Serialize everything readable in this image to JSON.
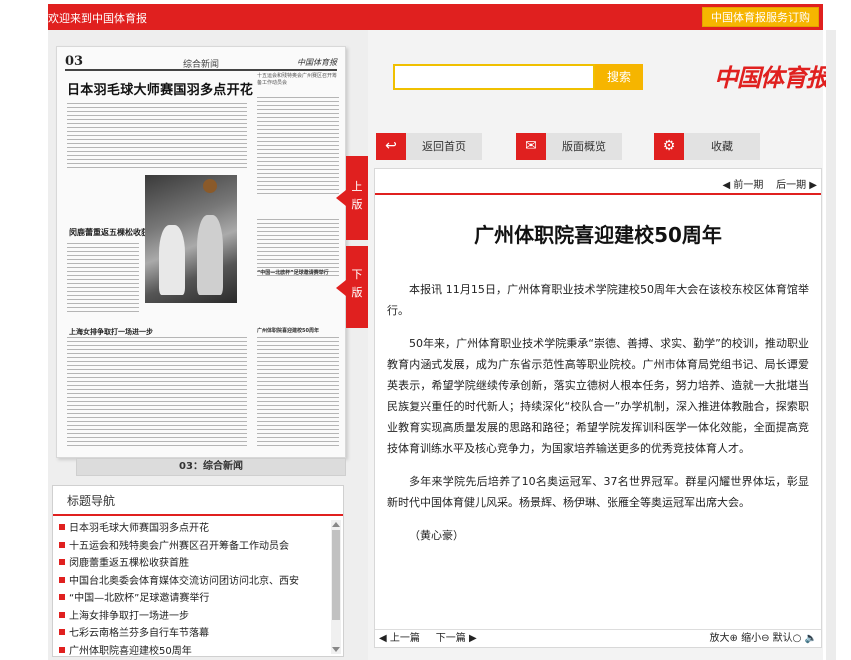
{
  "topbar": {
    "welcome": "欢迎来到中国体育报",
    "subscribe": "中国体育报服务订购"
  },
  "paper": {
    "page_num": "03",
    "section": "综合新闻",
    "masthead_small": "中国体育报",
    "headline": "日本羽毛球大师赛国羽多点开花",
    "side_titles": [
      "十五运会和残特奥会广州赛区召开筹备工作动员会",
      "闵鹿蕾重返五棵松收获首胜",
      "中国台北奥委会体育媒体交流访问团访问北京、西安",
      "“中国—北欧杯”足球邀请赛举行",
      "上海女排争取打一场进一步",
      "七彩云南格兰芬多自行车节落幕",
      "广州体职院喜迎建校50周年"
    ],
    "caption": "03：综合新闻"
  },
  "tabs": {
    "up": "上版",
    "down": "下版"
  },
  "nav": {
    "title": "标题导航",
    "items": [
      "日本羽毛球大师赛国羽多点开花",
      "十五运会和残特奥会广州赛区召开筹备工作动员会",
      "闵鹿蕾重返五棵松收获首胜",
      "中国台北奥委会体育媒体交流访问团访问北京、西安",
      "“中国—北欧杯”足球邀请赛举行",
      "上海女排争取打一场进一步",
      "七彩云南格兰芬多自行车节落幕",
      "广州体职院喜迎建校50周年"
    ]
  },
  "search": {
    "button": "搜索",
    "placeholder": ""
  },
  "logo": "中国体育报",
  "toolbar": {
    "home": "返回首页",
    "overview": "版面概览",
    "favorite": "收藏"
  },
  "article": {
    "pager_prev": "◀ 前一期",
    "pager_next": "后一期 ▶",
    "title": "广州体职院喜迎建校50周年",
    "paragraphs": [
      "本报讯  11月15日，广州体育职业技术学院建校50周年大会在该校东校区体育馆举行。",
      "50年来，广州体育职业技术学院秉承“崇德、善搏、求实、勤学”的校训，推动职业教育内涵式发展，成为广东省示范性高等职业院校。广州市体育局党组书记、局长谭爱英表示，希望学院继续传承创新，落实立德树人根本任务，努力培养、造就一大批堪当民族复兴重任的时代新人；持续深化“校队合一”办学机制，深入推进体教融合，探索职业教育实现高质量发展的思路和路径；希望学院发挥训科医学一体化效能，全面提高竞技体育训练水平及核心竞争力，为国家培养输送更多的优秀竞技体育人才。",
      "多年来学院先后培养了10名奥运冠军、37名世界冠军。群星闪耀世界体坛，彰显新时代中国体育健儿风采。杨景辉、杨伊琳、张雁全等奥运冠军出席大会。",
      "（黄心豪）"
    ],
    "prev_article": "◀ 上一篇",
    "next_article": "下一篇 ▶",
    "zoom": "放大⊕ 缩小⊖ 默认○"
  }
}
